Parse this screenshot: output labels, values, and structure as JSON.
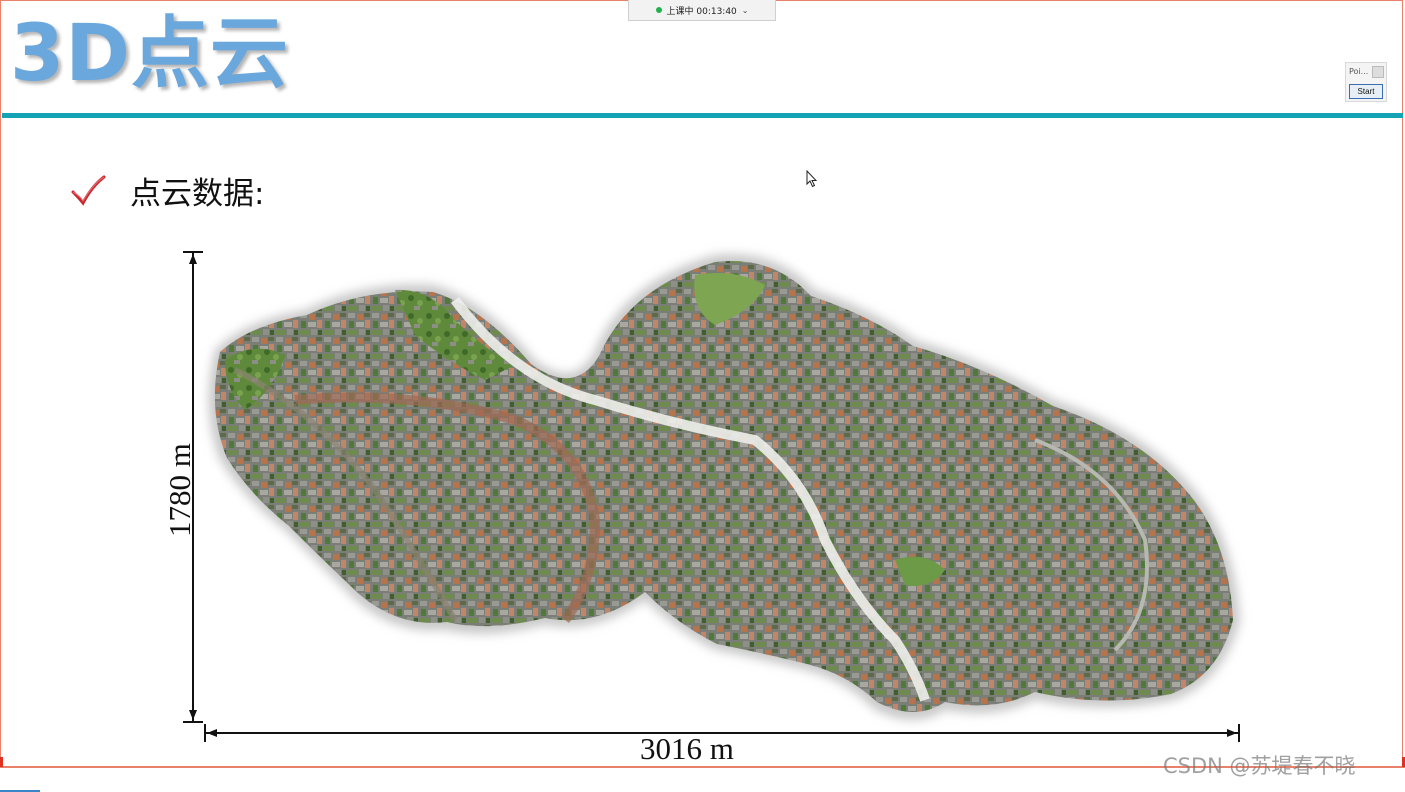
{
  "status_bar": {
    "label": "上课中 00:13:40",
    "status_color": "#22b14c"
  },
  "slide": {
    "title": "3D点云",
    "title_color": "#6aa7dc",
    "rule_color": "#14a3b4",
    "bullet": {
      "icon": "check-icon",
      "text": "点云数据:"
    },
    "figure": {
      "height_label": "1780 m",
      "width_label": "3016 m"
    }
  },
  "mini_panel": {
    "label": "Poi...",
    "start_label": "Start"
  },
  "watermark": "CSDN @苏堤春不晓"
}
